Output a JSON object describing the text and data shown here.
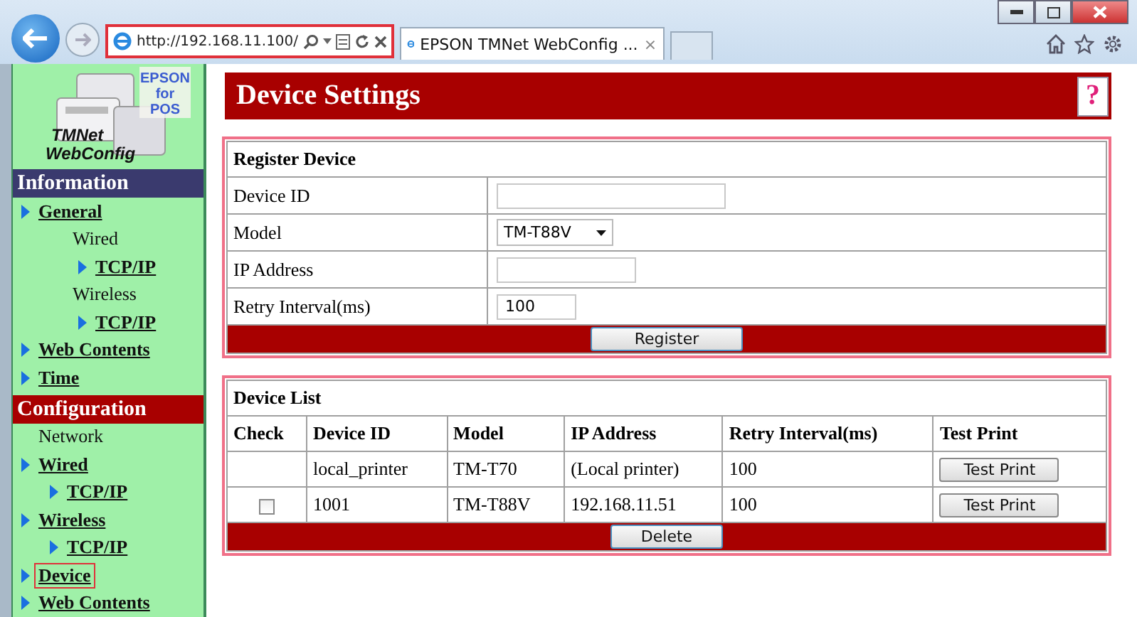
{
  "browser": {
    "address": "http://192.168.11.100/",
    "tab_title": "EPSON TMNet WebConfig ...",
    "tab_close": "×"
  },
  "logo": {
    "badge_lines": [
      "EPSON",
      "for",
      "POS"
    ],
    "title_lines": [
      "TMNet",
      "WebConfig"
    ]
  },
  "sidebar": {
    "sections": [
      {
        "title": "Information",
        "color": "#3a3a6e",
        "items": [
          {
            "label": "General",
            "kind": "link",
            "selected": false,
            "children": [
              {
                "label": "Wired",
                "kind": "text",
                "selected": false,
                "children": [
                  {
                    "label": "TCP/IP",
                    "kind": "link",
                    "selected": false
                  }
                ]
              },
              {
                "label": "Wireless",
                "kind": "text",
                "selected": false,
                "children": [
                  {
                    "label": "TCP/IP",
                    "kind": "link",
                    "selected": false
                  }
                ]
              }
            ]
          },
          {
            "label": "Web Contents",
            "kind": "link",
            "selected": false
          },
          {
            "label": "Time",
            "kind": "link",
            "selected": false
          }
        ]
      },
      {
        "title": "Configuration",
        "color": "#a80000",
        "items": [
          {
            "label": "Network",
            "kind": "text",
            "selected": false,
            "children": [
              {
                "label": "Wired",
                "kind": "link",
                "selected": false,
                "children": [
                  {
                    "label": "TCP/IP",
                    "kind": "link",
                    "selected": false
                  }
                ]
              },
              {
                "label": "Wireless",
                "kind": "link",
                "selected": false,
                "children": [
                  {
                    "label": "TCP/IP",
                    "kind": "link",
                    "selected": false
                  }
                ]
              },
              {
                "label": "Device",
                "kind": "link",
                "selected": true
              },
              {
                "label": "Web Contents",
                "kind": "link",
                "selected": false
              }
            ]
          }
        ]
      }
    ]
  },
  "page_title": "Device Settings",
  "help": "?",
  "register": {
    "title": "Register Device",
    "rows": [
      {
        "label": "Device ID",
        "kind": "text",
        "value": ""
      },
      {
        "label": "Model",
        "kind": "select",
        "value": "TM-T88V"
      },
      {
        "label": "IP Address",
        "kind": "text",
        "value": ""
      },
      {
        "label": "Retry Interval(ms)",
        "kind": "text",
        "value": "100"
      }
    ],
    "button": "Register"
  },
  "device_list": {
    "title": "Device List",
    "columns": [
      "Check",
      "Device ID",
      "Model",
      "IP Address",
      "Retry Interval(ms)",
      "Test Print"
    ],
    "rows": [
      {
        "kind": "fixed",
        "device_id": "local_printer",
        "model": "TM-T70",
        "ip": "(Local printer)",
        "retry": "100",
        "button": "Test Print"
      },
      {
        "kind": "checkable",
        "checked": false,
        "device_id": "1001",
        "model": "TM-T88V",
        "ip": "192.168.11.51",
        "retry": "100",
        "button": "Test Print"
      }
    ],
    "button": "Delete"
  }
}
